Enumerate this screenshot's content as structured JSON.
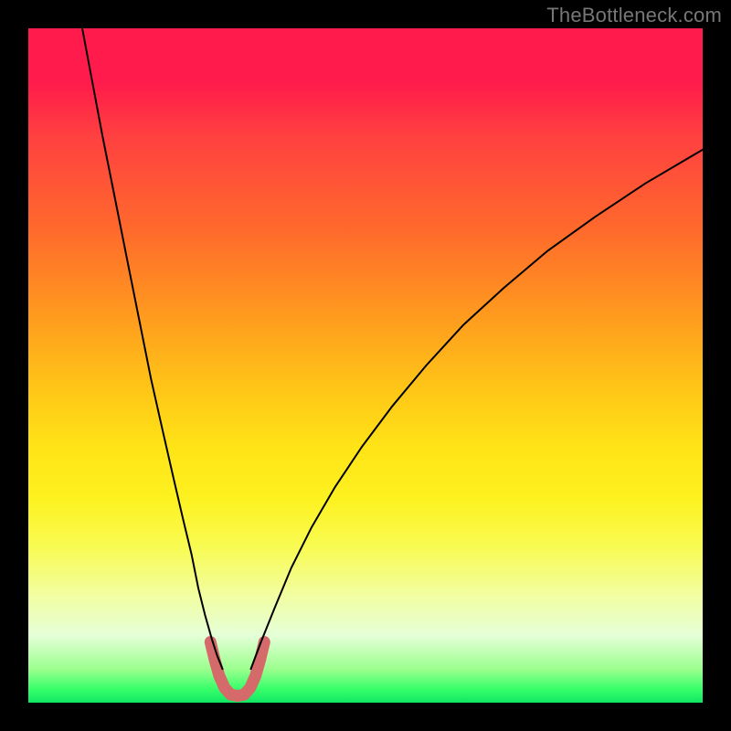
{
  "watermark": "TheBottleneck.com",
  "chart_data": {
    "type": "line",
    "title": "",
    "xlabel": "",
    "ylabel": "",
    "xlim": [
      0,
      100
    ],
    "ylim": [
      0,
      100
    ],
    "grid": false,
    "legend": false,
    "gradient_stops": [
      {
        "pos": 0,
        "color": "#ff1b4b"
      },
      {
        "pos": 30,
        "color": "#ff6a2c"
      },
      {
        "pos": 60,
        "color": "#ffe317"
      },
      {
        "pos": 85,
        "color": "#f2fea0"
      },
      {
        "pos": 100,
        "color": "#10e765"
      }
    ],
    "series": [
      {
        "name": "left-branch",
        "stroke": "#000000",
        "stroke_width": 2,
        "points": [
          {
            "x": 8.0,
            "y": 100.0
          },
          {
            "x": 9.5,
            "y": 92.0
          },
          {
            "x": 11.0,
            "y": 84.0
          },
          {
            "x": 12.8,
            "y": 75.0
          },
          {
            "x": 14.6,
            "y": 66.0
          },
          {
            "x": 16.4,
            "y": 57.0
          },
          {
            "x": 18.2,
            "y": 48.0
          },
          {
            "x": 20.0,
            "y": 40.0
          },
          {
            "x": 21.6,
            "y": 33.0
          },
          {
            "x": 23.0,
            "y": 27.0
          },
          {
            "x": 24.2,
            "y": 22.0
          },
          {
            "x": 25.2,
            "y": 17.0
          },
          {
            "x": 26.2,
            "y": 13.0
          },
          {
            "x": 27.2,
            "y": 9.5
          },
          {
            "x": 28.0,
            "y": 7.0
          },
          {
            "x": 28.8,
            "y": 5.0
          }
        ]
      },
      {
        "name": "right-branch",
        "stroke": "#000000",
        "stroke_width": 2,
        "points": [
          {
            "x": 33.0,
            "y": 5.0
          },
          {
            "x": 34.5,
            "y": 9.0
          },
          {
            "x": 36.5,
            "y": 14.0
          },
          {
            "x": 39.0,
            "y": 20.0
          },
          {
            "x": 42.0,
            "y": 26.0
          },
          {
            "x": 45.5,
            "y": 32.0
          },
          {
            "x": 49.5,
            "y": 38.0
          },
          {
            "x": 54.0,
            "y": 44.0
          },
          {
            "x": 59.0,
            "y": 50.0
          },
          {
            "x": 64.5,
            "y": 56.0
          },
          {
            "x": 70.5,
            "y": 61.5
          },
          {
            "x": 77.0,
            "y": 67.0
          },
          {
            "x": 84.0,
            "y": 72.0
          },
          {
            "x": 91.5,
            "y": 77.0
          },
          {
            "x": 100.0,
            "y": 82.0
          }
        ]
      },
      {
        "name": "bottom-u-highlight",
        "stroke": "#d46a6a",
        "stroke_width": 13,
        "points": [
          {
            "x": 27.0,
            "y": 9.0
          },
          {
            "x": 27.6,
            "y": 6.5
          },
          {
            "x": 28.3,
            "y": 4.0
          },
          {
            "x": 29.1,
            "y": 2.2
          },
          {
            "x": 30.0,
            "y": 1.2
          },
          {
            "x": 31.0,
            "y": 1.0
          },
          {
            "x": 32.0,
            "y": 1.2
          },
          {
            "x": 32.9,
            "y": 2.2
          },
          {
            "x": 33.7,
            "y": 4.0
          },
          {
            "x": 34.4,
            "y": 6.5
          },
          {
            "x": 35.0,
            "y": 9.0
          }
        ]
      }
    ]
  }
}
